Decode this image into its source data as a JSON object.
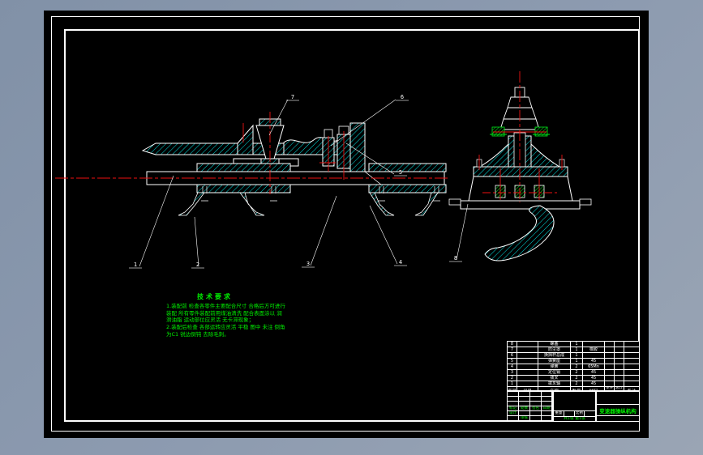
{
  "colors": {
    "bg": "#8d9bb0",
    "sheet": "#000000",
    "line": "#ffffff",
    "hatch": "#00e0e0",
    "centerline": "#ee1111",
    "annotation": "#00ef00"
  },
  "callouts": {
    "n1": "1",
    "n2": "2",
    "n3": "3",
    "n4": "4",
    "n5": "5",
    "n6": "6",
    "n7": "7",
    "n8": "8"
  },
  "notes": {
    "title": "技术要求",
    "line1": "1.装配前 检查各零件主要配合尺寸 合格后方可进行",
    "line2": "装配 所有零件装配前用煤油清洗 配合表面涂以 润",
    "line3": "滑油脂 运动部位应灵活 无卡滞现象；",
    "line4": "2.装配后检查 各部运转应灵活 平稳 图中 未注 倒角",
    "line5": "为C1 锐边倒钝 去除毛刺。"
  },
  "bom": {
    "header": {
      "no": "序号",
      "code": "代号",
      "name": "名称",
      "qty": "数量",
      "material": "材料",
      "unit": "单件",
      "total": "总计",
      "weight": "重量",
      "remark": "备注"
    },
    "rows": [
      {
        "no": "8",
        "code": "",
        "name": "螺塞",
        "qty": "1",
        "material": "",
        "remark": ""
      },
      {
        "no": "7",
        "code": "",
        "name": "防尘罩",
        "qty": "1",
        "material": "橡胶",
        "remark": ""
      },
      {
        "no": "6",
        "code": "",
        "name": "换挡杆总成",
        "qty": "1",
        "material": "",
        "remark": ""
      },
      {
        "no": "5",
        "code": "",
        "name": "弹簧座",
        "qty": "1",
        "material": "45",
        "remark": ""
      },
      {
        "no": "4",
        "code": "",
        "name": "弹簧",
        "qty": "2",
        "material": "65Mn",
        "remark": ""
      },
      {
        "no": "3",
        "code": "",
        "name": "定位销",
        "qty": "2",
        "material": "45",
        "remark": ""
      },
      {
        "no": "2",
        "code": "",
        "name": "拨叉",
        "qty": "2",
        "material": "45",
        "remark": ""
      },
      {
        "no": "1",
        "code": "",
        "name": "拨叉轴",
        "qty": "2",
        "material": "45",
        "remark": ""
      }
    ]
  },
  "titleblock": {
    "title": "变速器操纵机构",
    "sig": {
      "r4c1": "标记",
      "r4c2": "处数",
      "r4c3": "签名",
      "r4c4": "日期",
      "r5c1": "设计",
      "r6c2": "审核"
    },
    "middle": {
      "c1": "重量",
      "c3": "比例",
      "sheets": "共1张 第1张"
    }
  }
}
